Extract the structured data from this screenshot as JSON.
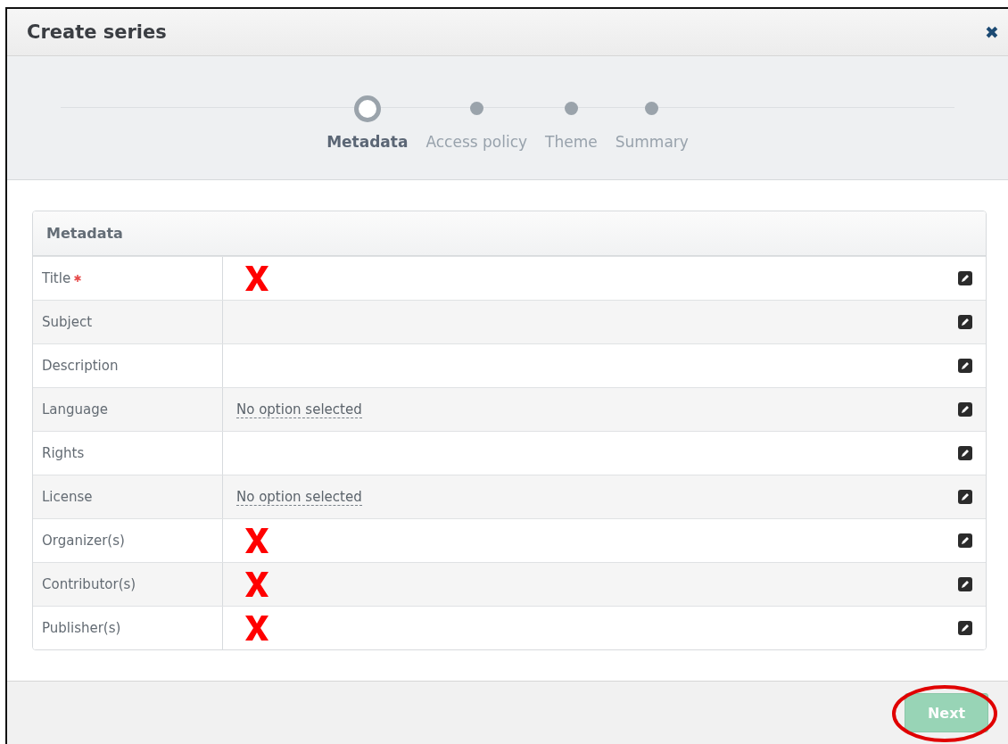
{
  "dialog": {
    "title": "Create series",
    "close": "✖"
  },
  "steps": [
    {
      "label": "Metadata",
      "selected": true
    },
    {
      "label": "Access policy",
      "selected": false
    },
    {
      "label": "Theme",
      "selected": false
    },
    {
      "label": "Summary",
      "selected": false
    }
  ],
  "table": {
    "title": "Metadata",
    "rows": [
      {
        "label": "Title",
        "required": true,
        "marked": true
      },
      {
        "label": "Subject",
        "required": false,
        "marked": false
      },
      {
        "label": "Description",
        "required": false,
        "marked": false
      },
      {
        "label": "Language",
        "required": false,
        "marked": false,
        "value": "No option selected"
      },
      {
        "label": "Rights",
        "required": false,
        "marked": false
      },
      {
        "label": "License",
        "required": false,
        "marked": false,
        "value": "No option selected"
      },
      {
        "label": "Organizer(s)",
        "required": false,
        "marked": true
      },
      {
        "label": "Contributor(s)",
        "required": false,
        "marked": true
      },
      {
        "label": "Publisher(s)",
        "required": false,
        "marked": true
      }
    ]
  },
  "footer": {
    "next": {
      "label": "Next",
      "disabled": true,
      "highlighted": true
    }
  }
}
